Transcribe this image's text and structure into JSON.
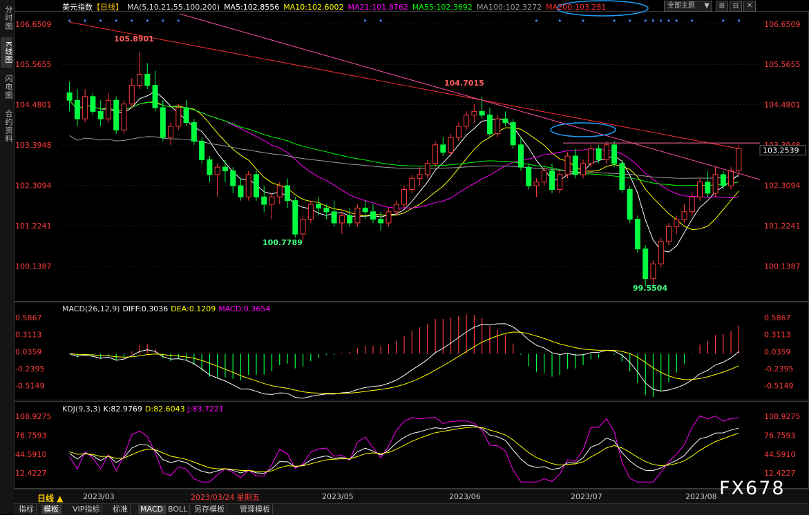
{
  "left_toolbar": {
    "items": [
      {
        "label": "分时图",
        "active": false
      },
      {
        "label": "K线图",
        "active": true
      },
      {
        "label": "闪电图",
        "active": false
      },
      {
        "label": "合约资料",
        "active": false
      }
    ]
  },
  "header": {
    "instrument": "美元指数",
    "period_tag": "【日线】",
    "ma_params": "MA(5,10,21,55,100,200)",
    "ma5": "MA5:102.8556",
    "ma10": "MA10:102.6002",
    "ma21": "MA21:101.8762",
    "ma55": "MA55:102.3692",
    "ma100": "MA100:102.3272",
    "ma200": "MA200:103.281",
    "theme_label": "全部主题",
    "theme_arrow": "▼",
    "ctrl_buttons": [
      "⊞",
      "⊟",
      "✕"
    ]
  },
  "colors": {
    "up": "#ff3b3b",
    "down": "#00ff40",
    "ma5": "#ffffff",
    "ma10": "#ffff00",
    "ma21": "#ff00ff",
    "ma55": "#00ff00",
    "ma100": "#9c9c9c",
    "ma200": "#ff3030",
    "axis_text": "#ff3b3b",
    "trendline": "#ff4da6",
    "highlight_ellipse": "#1ea0ff"
  },
  "price_axis": {
    "ticks": [
      "106.6509",
      "105.5655",
      "104.4801",
      "103.3948",
      "102.3094",
      "101.2241",
      "100.1387"
    ],
    "current_price": "103.2539"
  },
  "annotations": {
    "high_1": "105.8901",
    "high_2": "104.7015",
    "low_1": "100.7789",
    "low_2": "99.5504"
  },
  "macd_panel": {
    "title": "MACD(26,12,9)",
    "diff": "DIFF:0.3036",
    "dea": "DEA:0.1209",
    "macd": "MACD:0.3654",
    "ticks": [
      "0.5867",
      "0.3113",
      "0.0359",
      "-0.2395",
      "-0.5149"
    ]
  },
  "kdj_panel": {
    "title": "KDJ(9,3,3)",
    "k": "K:82.9769",
    "d": "D:82.6043",
    "j": "J:83.7221",
    "ticks": [
      "108.9275",
      "76.7593",
      "44.5910",
      "12.4227"
    ]
  },
  "date_axis": {
    "period_button": "日线 ▲",
    "cursor_date": "2023/03/24 星期五",
    "labels": [
      "2023/03",
      "2023/05",
      "2023/06",
      "2023/07",
      "2023/08"
    ]
  },
  "bottom_tabs": [
    "指标",
    "模板",
    "VIP指标",
    "标准",
    "MACD",
    "BOLL",
    "另存模板",
    "管理模板"
  ],
  "bottom_tabs_active": [
    1,
    4
  ],
  "watermark": "FX678",
  "chart_data": {
    "type": "candlestick",
    "title": "美元指数 【日线】",
    "ylim": [
      99.2,
      107.0
    ],
    "candles": [
      [
        104.8,
        105.1,
        104.3,
        104.6
      ],
      [
        104.6,
        104.9,
        103.9,
        104.1
      ],
      [
        104.1,
        104.9,
        104.0,
        104.7
      ],
      [
        104.7,
        104.8,
        104.2,
        104.3
      ],
      [
        104.3,
        104.6,
        103.9,
        104.1
      ],
      [
        104.1,
        104.8,
        104.0,
        104.6
      ],
      [
        104.6,
        104.7,
        103.7,
        103.8
      ],
      [
        103.8,
        104.6,
        103.7,
        104.5
      ],
      [
        104.5,
        105.2,
        104.4,
        105.0
      ],
      [
        105.0,
        105.9,
        104.9,
        105.3
      ],
      [
        105.3,
        105.6,
        104.9,
        105.0
      ],
      [
        105.0,
        105.4,
        104.3,
        104.4
      ],
      [
        104.4,
        104.6,
        103.5,
        103.6
      ],
      [
        103.6,
        104.0,
        103.4,
        103.9
      ],
      [
        103.9,
        104.5,
        103.8,
        104.4
      ],
      [
        104.4,
        104.6,
        103.9,
        104.0
      ],
      [
        104.0,
        104.1,
        103.4,
        103.5
      ],
      [
        103.5,
        103.6,
        102.9,
        103.0
      ],
      [
        103.0,
        103.1,
        102.4,
        102.6
      ],
      [
        102.6,
        102.9,
        102.0,
        102.8
      ],
      [
        102.8,
        103.0,
        102.4,
        102.7
      ],
      [
        102.7,
        102.8,
        102.1,
        102.3
      ],
      [
        102.3,
        102.5,
        101.9,
        102.0
      ],
      [
        102.0,
        102.7,
        101.9,
        102.6
      ],
      [
        102.6,
        102.7,
        101.9,
        102.0
      ],
      [
        102.0,
        102.3,
        101.6,
        101.8
      ],
      [
        101.8,
        102.1,
        101.4,
        102.0
      ],
      [
        102.0,
        102.4,
        101.8,
        102.3
      ],
      [
        102.3,
        102.5,
        101.7,
        101.9
      ],
      [
        101.9,
        102.0,
        100.9,
        101.0
      ],
      [
        101.0,
        101.5,
        100.8,
        101.4
      ],
      [
        101.4,
        101.9,
        101.3,
        101.8
      ],
      [
        101.8,
        102.0,
        101.5,
        101.7
      ],
      [
        101.7,
        101.8,
        101.4,
        101.6
      ],
      [
        101.6,
        101.9,
        101.2,
        101.3
      ],
      [
        101.3,
        101.6,
        101.0,
        101.5
      ],
      [
        101.5,
        101.7,
        101.2,
        101.3
      ],
      [
        101.3,
        101.8,
        101.2,
        101.7
      ],
      [
        101.7,
        101.9,
        101.4,
        101.6
      ],
      [
        101.6,
        101.8,
        101.3,
        101.4
      ],
      [
        101.4,
        101.6,
        101.1,
        101.3
      ],
      [
        101.3,
        101.7,
        101.2,
        101.6
      ],
      [
        101.6,
        101.9,
        101.5,
        101.8
      ],
      [
        101.8,
        102.3,
        101.7,
        102.2
      ],
      [
        102.2,
        102.6,
        102.1,
        102.5
      ],
      [
        102.5,
        102.8,
        102.3,
        102.6
      ],
      [
        102.6,
        103.0,
        102.5,
        102.9
      ],
      [
        102.9,
        103.5,
        102.8,
        103.4
      ],
      [
        103.4,
        103.6,
        103.1,
        103.2
      ],
      [
        103.2,
        103.7,
        103.1,
        103.6
      ],
      [
        103.6,
        104.0,
        103.5,
        103.9
      ],
      [
        103.9,
        104.3,
        103.8,
        104.2
      ],
      [
        104.2,
        104.5,
        104.0,
        104.3
      ],
      [
        104.3,
        104.7,
        104.1,
        104.2
      ],
      [
        104.2,
        104.4,
        103.6,
        103.7
      ],
      [
        103.7,
        104.2,
        103.6,
        104.1
      ],
      [
        104.1,
        104.3,
        103.9,
        104.0
      ],
      [
        104.0,
        104.1,
        103.3,
        103.4
      ],
      [
        103.4,
        103.6,
        102.7,
        102.8
      ],
      [
        102.8,
        102.9,
        102.2,
        102.3
      ],
      [
        102.3,
        102.5,
        102.0,
        102.4
      ],
      [
        102.4,
        102.8,
        102.3,
        102.7
      ],
      [
        102.7,
        102.9,
        102.1,
        102.2
      ],
      [
        102.2,
        102.7,
        102.1,
        102.6
      ],
      [
        102.6,
        103.2,
        102.5,
        103.1
      ],
      [
        103.1,
        103.3,
        102.5,
        102.6
      ],
      [
        102.6,
        103.0,
        102.5,
        102.9
      ],
      [
        102.9,
        103.4,
        102.8,
        103.3
      ],
      [
        103.3,
        103.4,
        102.9,
        103.0
      ],
      [
        103.0,
        103.5,
        102.9,
        103.4
      ],
      [
        103.4,
        103.5,
        102.8,
        102.9
      ],
      [
        102.9,
        103.0,
        102.1,
        102.2
      ],
      [
        102.2,
        102.3,
        101.3,
        101.4
      ],
      [
        101.4,
        101.5,
        100.5,
        100.6
      ],
      [
        100.6,
        100.7,
        99.6,
        99.8
      ],
      [
        99.8,
        100.3,
        99.6,
        100.2
      ],
      [
        100.2,
        100.9,
        100.1,
        100.8
      ],
      [
        100.8,
        101.3,
        100.7,
        101.2
      ],
      [
        101.2,
        101.5,
        101.0,
        101.4
      ],
      [
        101.4,
        101.8,
        101.3,
        101.6
      ],
      [
        101.6,
        102.1,
        101.5,
        102.0
      ],
      [
        102.0,
        102.5,
        101.9,
        102.4
      ],
      [
        102.4,
        102.7,
        102.0,
        102.1
      ],
      [
        102.1,
        102.8,
        102.0,
        102.6
      ],
      [
        102.6,
        102.7,
        102.2,
        102.3
      ],
      [
        102.3,
        102.8,
        102.2,
        102.7
      ],
      [
        102.7,
        103.4,
        102.6,
        103.3
      ]
    ]
  }
}
